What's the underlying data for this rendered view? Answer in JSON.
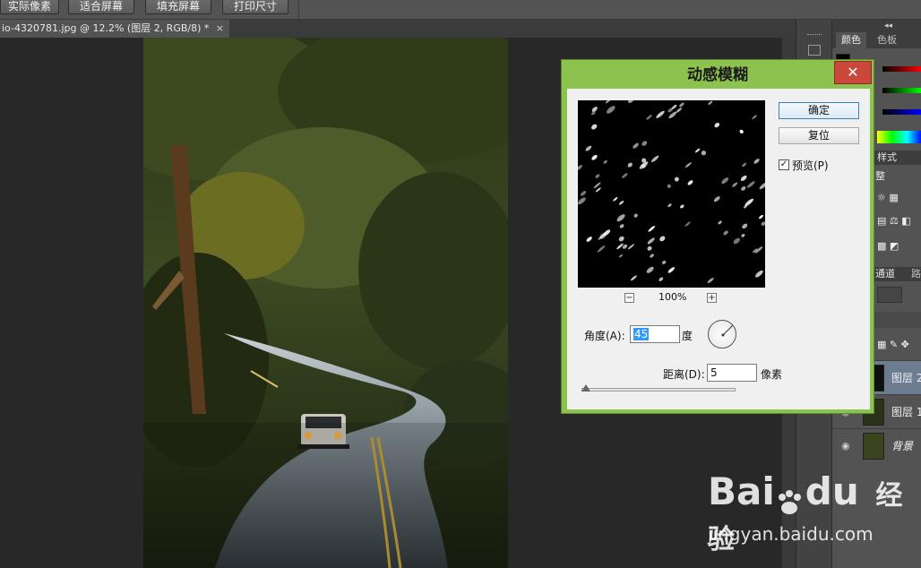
{
  "options_bar": {
    "buttons": [
      "实际像素",
      "适合屏幕",
      "填充屏幕",
      "打印尺寸"
    ]
  },
  "document_tab": {
    "title": "io-4320781.jpg @ 12.2% (图层 2, RGB/8) *",
    "close": "×"
  },
  "right_panel": {
    "collapse_glyph": "◂◂",
    "tabs": [
      "颜色",
      "色板"
    ],
    "styles_tab": "样式",
    "adjust_label": "整",
    "channels_tab": "通道",
    "paths_tab": "路",
    "layers": [
      {
        "name": "图层 2",
        "selected": true
      },
      {
        "name": "图层 1",
        "selected": false
      },
      {
        "name": "背景",
        "selected": false
      }
    ]
  },
  "dialog": {
    "title": "动感模糊",
    "close": "✕",
    "ok_label": "确定",
    "reset_label": "复位",
    "preview_label": "预览(P)",
    "preview_checked": true,
    "zoom_minus": "−",
    "zoom_plus": "+",
    "zoom_level": "100%",
    "angle_label": "角度(A):",
    "angle_value": "45",
    "angle_unit": "度",
    "distance_label": "距离(D):",
    "distance_value": "5",
    "distance_unit": "像素"
  },
  "watermark": {
    "brand": "Bai",
    "brand_suffix": "du",
    "brand_cn": "经验",
    "url": "jingyan.baidu.com"
  },
  "colors": {
    "dialog_frame": "#8cc34e",
    "close_red": "#c9473b",
    "selected_layer": "#6c7d92",
    "ps_panel": "#535353"
  }
}
